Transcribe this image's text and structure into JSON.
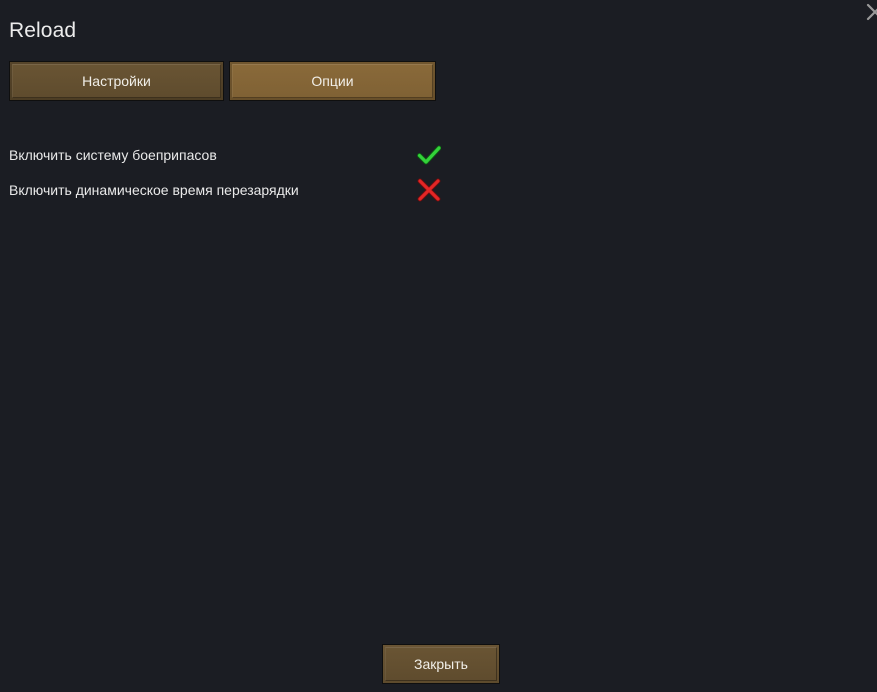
{
  "window": {
    "title": "Reload"
  },
  "tabs": [
    {
      "label": "Настройки",
      "selected": false
    },
    {
      "label": "Опции",
      "selected": true
    }
  ],
  "options": [
    {
      "label": "Включить систему боеприпасов",
      "enabled": true,
      "icon": "checkmark-icon"
    },
    {
      "label": "Включить динамическое время перезарядки",
      "enabled": false,
      "icon": "cross-icon"
    }
  ],
  "footer": {
    "close_label": "Закрыть"
  },
  "colors": {
    "background": "#1b1d23",
    "button": "#5e4b2d",
    "button_active": "#7f6134",
    "check": "#2fd62f",
    "cross": "#e02a2a"
  }
}
